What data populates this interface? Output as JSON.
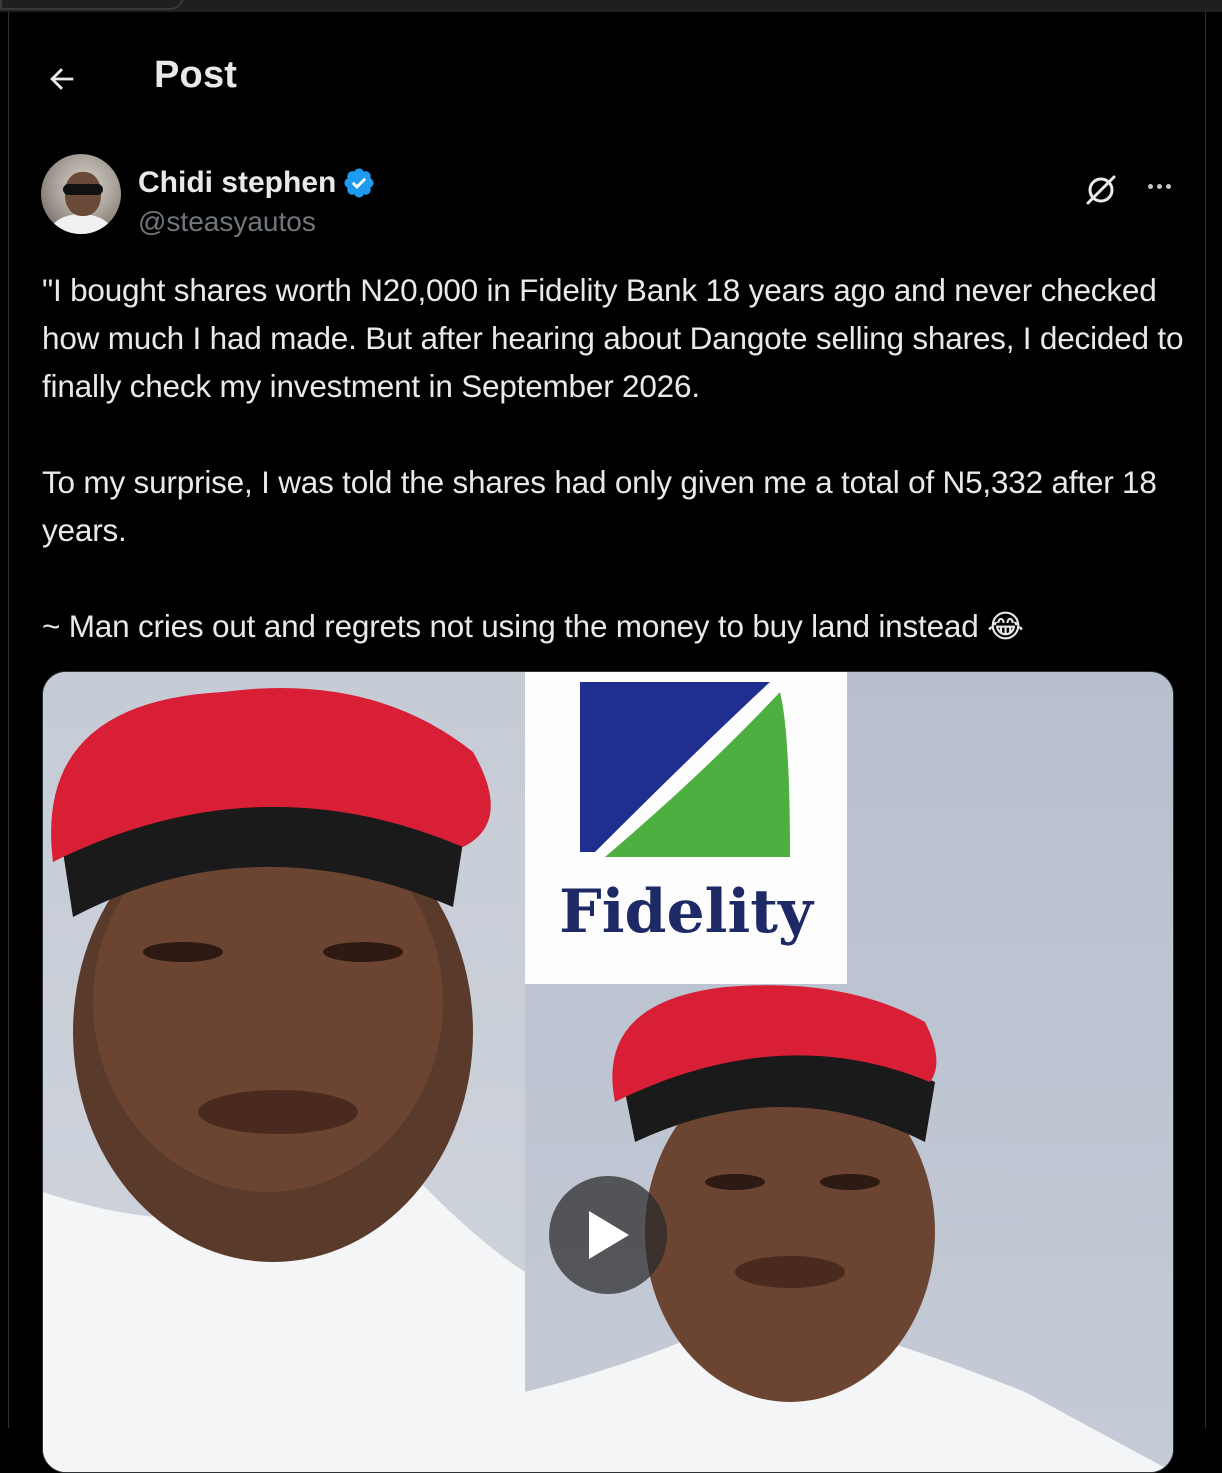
{
  "header": {
    "title": "Post"
  },
  "icons": {
    "back": "arrow-left-icon",
    "verified": "verified-badge-icon",
    "grok": "grok-icon",
    "more": "more-horizontal-icon",
    "play": "play-icon"
  },
  "colors": {
    "background": "#000000",
    "text": "#e7e9ea",
    "muted": "#71767b",
    "verified": "#1d9bf0"
  },
  "post": {
    "author": {
      "display_name": "Chidi stephen",
      "handle": "@steasyautos",
      "verified": true
    },
    "paragraphs": [
      "\"I bought shares worth N20,000 in Fidelity Bank 18 years ago and never checked how much I had made. But after hearing about Dangote selling shares, I decided to finally check my investment in September 2026.",
      "To my surprise, I was told the shares had only given me a total of N5,332 after 18 years.",
      "~ Man cries out and regrets not using the money to buy land instead 😂"
    ],
    "media": {
      "type": "video",
      "logo_text": "Fidelity"
    }
  }
}
